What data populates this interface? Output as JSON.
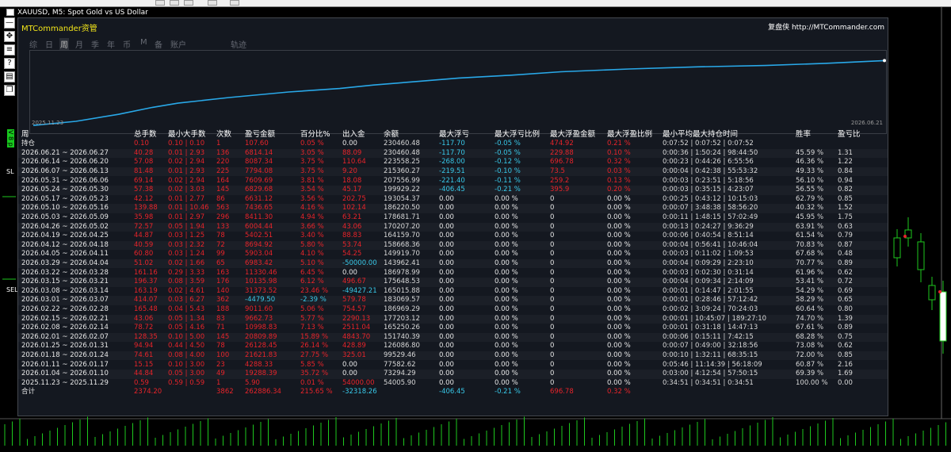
{
  "chart": {
    "title": "XAUUSD, M5:  Spot Gold vs US Dollar",
    "side_labels": [
      "V 8 p",
      "SL",
      "SEL"
    ]
  },
  "panel": {
    "app_name": "MTCommander资管",
    "brand": "复盘侠 http://MTCommander.com",
    "tabs": [
      {
        "label": "综",
        "active": false
      },
      {
        "label": "日",
        "active": false
      },
      {
        "label": "周",
        "active": true
      },
      {
        "label": "月",
        "active": false
      },
      {
        "label": "季",
        "active": false
      },
      {
        "label": "年",
        "active": false
      },
      {
        "label": "币",
        "active": false
      },
      {
        "label": "M",
        "active": false
      },
      {
        "label": "备",
        "active": false
      },
      {
        "label": "账户",
        "active": false
      },
      {
        "label": "轨迹",
        "active": false
      }
    ],
    "curve": {
      "start_date": "2025.11.23",
      "end_date": "2026.06.21",
      "line_color": "#29a8e8",
      "points": [
        [
          0,
          0.98
        ],
        [
          0.05,
          0.92
        ],
        [
          0.1,
          0.82
        ],
        [
          0.14,
          0.72
        ],
        [
          0.17,
          0.66
        ],
        [
          0.23,
          0.58
        ],
        [
          0.3,
          0.5
        ],
        [
          0.36,
          0.45
        ],
        [
          0.4,
          0.4
        ],
        [
          0.45,
          0.35
        ],
        [
          0.5,
          0.3
        ],
        [
          0.56,
          0.26
        ],
        [
          0.62,
          0.21
        ],
        [
          0.7,
          0.17
        ],
        [
          0.78,
          0.14
        ],
        [
          0.86,
          0.12
        ],
        [
          0.93,
          0.09
        ],
        [
          1,
          0.05
        ]
      ]
    }
  },
  "table": {
    "headers": [
      "周",
      "总手数",
      "最小大手数",
      "次数",
      "盈亏金额",
      "百分比%",
      "出入金",
      "余额",
      "最大浮亏",
      "最大浮亏比例",
      "最大浮盈金额",
      "最大浮盈比例",
      "最小平均最大持仓时间",
      "胜率",
      "盈亏比"
    ],
    "rows": [
      [
        "持仓",
        "0.10",
        "0.10 | 0.10",
        "1",
        "107.60",
        "0.05 %",
        "0.00",
        "230460.48",
        "-117.70",
        "-0.05 %",
        "474.92",
        "0.21 %",
        "0:07:52 | 0:07:52 | 0:07:52",
        "",
        ""
      ],
      [
        "2026.06.21 ~ 2026.06.27",
        "40.28",
        "0.01 | 2.93",
        "136",
        "6814.14",
        "3.05 %",
        "88.09",
        "230460.48",
        "-117.70",
        "-0.05 %",
        "229.88",
        "0.10 %",
        "0:00:36 | 1:50:24 | 98:44:50",
        "45.59 %",
        "1.31"
      ],
      [
        "2026.06.14 ~ 2026.06.20",
        "57.08",
        "0.02 | 2.94",
        "220",
        "8087.34",
        "3.75 %",
        "110.64",
        "223558.25",
        "-268.00",
        "-0.12 %",
        "696.78",
        "0.32 %",
        "0:00:23 | 0:44:26 | 6:55:56",
        "46.36 %",
        "1.22"
      ],
      [
        "2026.06.07 ~ 2026.06.13",
        "81.48",
        "0.01 | 2.93",
        "225",
        "7794.08",
        "3.75 %",
        "9.20",
        "215360.27",
        "-219.51",
        "-0.10 %",
        "73.5",
        "0.03 %",
        "0:00:04 | 0:42:38 | 55:53:32",
        "49.33 %",
        "0.84"
      ],
      [
        "2026.05.31 ~ 2026.06.06",
        "69.14",
        "0.02 | 2.94",
        "164",
        "7609.69",
        "3.81 %",
        "18.08",
        "207556.99",
        "-221.40",
        "-0.11 %",
        "259.2",
        "0.13 %",
        "0:00:03 | 0:23:51 | 5:18:56",
        "56.10 %",
        "0.94"
      ],
      [
        "2026.05.24 ~ 2026.05.30",
        "57.38",
        "0.02 | 3.03",
        "145",
        "6829.68",
        "3.54 %",
        "45.17",
        "199929.22",
        "-406.45",
        "-0.21 %",
        "395.9",
        "0.20 %",
        "0:00:03 | 0:35:15 | 4:23:07",
        "56.55 %",
        "0.82"
      ],
      [
        "2026.05.17 ~ 2026.05.23",
        "42.12",
        "0.01 | 2.77",
        "86",
        "6631.12",
        "3.56 %",
        "202.75",
        "193054.37",
        "0.00",
        "0.00 %",
        "0",
        "0.00 %",
        "0:00:25 | 0:43:12 | 10:15:03",
        "62.79 %",
        "0.85"
      ],
      [
        "2026.05.10 ~ 2026.05.16",
        "139.88",
        "0.01 | 10.46",
        "563",
        "7436.65",
        "4.16 %",
        "102.14",
        "186220.50",
        "0.00",
        "0.00 %",
        "0",
        "0.00 %",
        "0:00:07 | 3:48:38 | 58:56:20",
        "40.32 %",
        "1.52"
      ],
      [
        "2026.05.03 ~ 2026.05.09",
        "35.98",
        "0.01 | 2.97",
        "296",
        "8411.30",
        "4.94 %",
        "63.21",
        "178681.71",
        "0.00",
        "0.00 %",
        "0",
        "0.00 %",
        "0:00:11 | 1:48:15 | 57:02:49",
        "45.95 %",
        "1.75"
      ],
      [
        "2026.04.26 ~ 2026.05.02",
        "72.57",
        "0.05 | 1.94",
        "133",
        "6004.44",
        "3.66 %",
        "43.06",
        "170207.20",
        "0.00",
        "0.00 %",
        "0",
        "0.00 %",
        "0:00:13 | 0:24:27 | 9:36:29",
        "63.91 %",
        "0.63"
      ],
      [
        "2026.04.19 ~ 2026.04.25",
        "44.87",
        "0.03 | 1.25",
        "78",
        "5402.51",
        "3.40 %",
        "88.83",
        "164159.70",
        "0.00",
        "0.00 %",
        "0",
        "0.00 %",
        "0:00:06 | 0:40:54 | 8:51:14",
        "61.54 %",
        "0.79"
      ],
      [
        "2026.04.12 ~ 2026.04.18",
        "40.59",
        "0.03 | 2.32",
        "72",
        "8694.92",
        "5.80 %",
        "53.74",
        "158668.36",
        "0.00",
        "0.00 %",
        "0",
        "0.00 %",
        "0:00:04 | 0:56:41 | 10:46:04",
        "70.83 %",
        "0.87"
      ],
      [
        "2026.04.05 ~ 2026.04.11",
        "60.80",
        "0.03 | 1.24",
        "99",
        "5903.04",
        "4.10 %",
        "54.25",
        "149919.70",
        "0.00",
        "0.00 %",
        "0",
        "0.00 %",
        "0:00:03 | 0:11:02 | 1:09:53",
        "67.68 %",
        "0.48"
      ],
      [
        "2026.03.29 ~ 2026.04.04",
        "51.02",
        "0.02 | 1.66",
        "65",
        "6983.42",
        "5.10 %",
        "-50000.00",
        "143962.41",
        "0.00",
        "0.00 %",
        "0",
        "0.00 %",
        "0:00:04 | 0:09:29 | 2:23:10",
        "70.77 %",
        "0.89"
      ],
      [
        "2026.03.22 ~ 2026.03.28",
        "161.16",
        "0.29 | 3.33",
        "163",
        "11330.46",
        "6.45 %",
        "0.00",
        "186978.99",
        "0.00",
        "0.00 %",
        "0",
        "0.00 %",
        "0:00:03 | 0:02:30 | 0:31:14",
        "61.96 %",
        "0.62"
      ],
      [
        "2026.03.15 ~ 2026.03.21",
        "196.37",
        "0.08 | 3.59",
        "176",
        "10135.98",
        "6.12 %",
        "496.67",
        "175648.53",
        "0.00",
        "0.00 %",
        "0",
        "0.00 %",
        "0:00:04 | 0:09:34 | 2:14:09",
        "53.41 %",
        "0.72"
      ],
      [
        "2026.03.08 ~ 2026.03.14",
        "163.19",
        "0.02 | 4.61",
        "140",
        "31373.52",
        "23.46 %",
        "-49427.21",
        "165015.88",
        "0.00",
        "0.00 %",
        "0",
        "0.00 %",
        "0:00:01 | 0:14:47 | 2:01:55",
        "54.29 %",
        "0.69"
      ],
      [
        "2026.03.01 ~ 2026.03.07",
        "414.07",
        "0.03 | 6.27",
        "362",
        "-4479.50",
        "-2.39 %",
        "579.78",
        "183069.57",
        "0.00",
        "0.00 %",
        "0",
        "0.00 %",
        "0:00:01 | 0:28:46 | 57:12:42",
        "58.29 %",
        "0.65"
      ],
      [
        "2026.02.22 ~ 2026.02.28",
        "165.48",
        "0.04 | 5.43",
        "188",
        "9011.60",
        "5.06 %",
        "754.57",
        "186969.29",
        "0.00",
        "0.00 %",
        "0",
        "0.00 %",
        "0:00:02 | 3:09:24 | 70:24:03",
        "60.64 %",
        "0.80"
      ],
      [
        "2026.02.15 ~ 2026.02.21",
        "43.06",
        "0.05 | 1.34",
        "83",
        "9662.73",
        "5.77 %",
        "2290.13",
        "177203.12",
        "0.00",
        "0.00 %",
        "0",
        "0.00 %",
        "0:00:01 | 10:45:07 | 189:27:10",
        "74.70 %",
        "1.39"
      ],
      [
        "2026.02.08 ~ 2026.02.14",
        "78.72",
        "0.05 | 4.16",
        "71",
        "10998.83",
        "7.13 %",
        "2511.04",
        "165250.26",
        "0.00",
        "0.00 %",
        "0",
        "0.00 %",
        "0:00:01 | 0:31:18 | 14:47:13",
        "67.61 %",
        "0.89"
      ],
      [
        "2026.02.01 ~ 2026.02.07",
        "128.35",
        "0.10 | 5.00",
        "145",
        "20809.89",
        "15.89 %",
        "4843.70",
        "151740.39",
        "0.00",
        "0.00 %",
        "0",
        "0.00 %",
        "0:00:06 | 0:15:11 | 7:42:15",
        "68.28 %",
        "0.75"
      ],
      [
        "2026.01.25 ~ 2026.01.31",
        "94.94",
        "0.44 | 4.50",
        "78",
        "26128.45",
        "26.14 %",
        "428.89",
        "126086.80",
        "0.00",
        "0.00 %",
        "0",
        "0.00 %",
        "0:00:07 | 0:49:00 | 32:18:56",
        "73.08 %",
        "0.62"
      ],
      [
        "2026.01.18 ~ 2026.01.24",
        "74.61",
        "0.08 | 4.00",
        "100",
        "21621.83",
        "27.75 %",
        "325.01",
        "99529.46",
        "0.00",
        "0.00 %",
        "0",
        "0.00 %",
        "0:00:10 | 1:32:11 | 68:35:15",
        "72.00 %",
        "0.85"
      ],
      [
        "2026.01.11 ~ 2026.01.17",
        "15.15",
        "0.10 | 3.00",
        "23",
        "4288.33",
        "5.85 %",
        "0.00",
        "77582.62",
        "0.00",
        "0.00 %",
        "0",
        "0.00 %",
        "0:05:46 | 11:14:39 | 56:18:09",
        "60.87 %",
        "2.16"
      ],
      [
        "2026.01.04 ~ 2026.01.10",
        "44.84",
        "0.05 | 3.00",
        "49",
        "19288.39",
        "35.72 %",
        "0.00",
        "73294.29",
        "0.00",
        "0.00 %",
        "0",
        "0.00 %",
        "0:03:00 | 4:12:54 | 57:50:15",
        "69.39 %",
        "1.69"
      ],
      [
        "2025.11.23 ~ 2025.11.29",
        "0.59",
        "0.59 | 0.59",
        "1",
        "5.90",
        "0.01 %",
        "54000.00",
        "54005.90",
        "0.00",
        "0.00 %",
        "0",
        "0.00 %",
        "0:34:51 | 0:34:51 | 0:34:51",
        "100.00 %",
        "0.00"
      ]
    ],
    "footer": [
      "合计",
      "2374.20",
      "",
      "3862",
      "262886.34",
      "215.65 %",
      "-32318.26",
      "",
      "-406.45",
      "-0.21 %",
      "696.78",
      "0.32 %",
      "",
      "",
      ""
    ]
  }
}
